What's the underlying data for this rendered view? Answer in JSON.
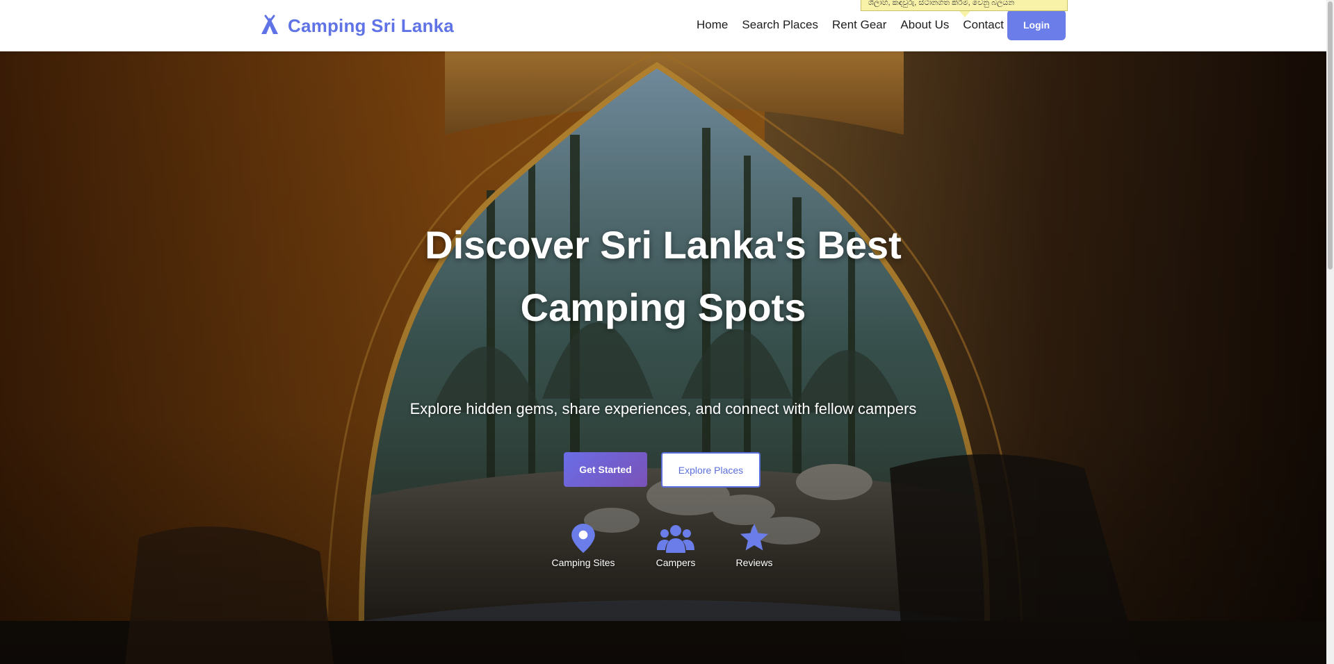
{
  "brand": {
    "name": "Camping Sri Lanka",
    "icon": "tent-icon"
  },
  "nav": {
    "items": [
      "Home",
      "Search Places",
      "Rent Gear",
      "About Us",
      "Contact"
    ],
    "login_label": "Login"
  },
  "tooltip": {
    "text": "ශිලාහ, කඳවුරු, ස්ථානගත කිරීම, වෙනු බලයන"
  },
  "hero": {
    "title_line1": "Discover Sri Lanka's Best",
    "title_line2": "Camping Spots",
    "subtitle": "Explore hidden gems, share experiences, and connect with fellow campers",
    "primary_button": "Get Started",
    "secondary_button": "Explore Places"
  },
  "stats": [
    {
      "label": "Camping Sites",
      "icon": "map-marker-icon"
    },
    {
      "label": "Campers",
      "icon": "users-icon"
    },
    {
      "label": "Reviews",
      "icon": "star-icon"
    }
  ],
  "colors": {
    "accent": "#5f73e6",
    "button_gradient_start": "#6a6de6",
    "button_gradient_end": "#7a52b8",
    "icon_color": "#6a7de8"
  }
}
